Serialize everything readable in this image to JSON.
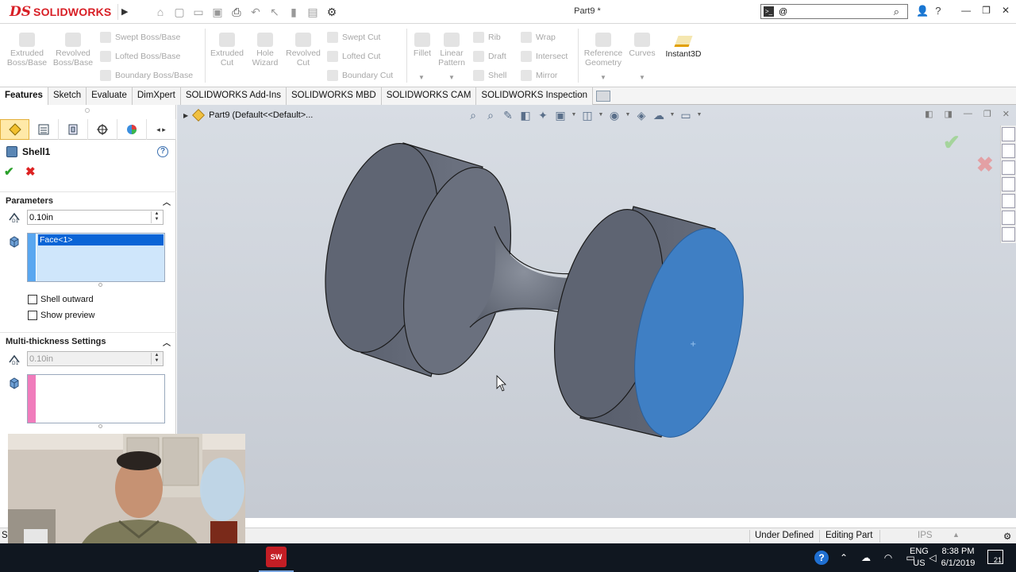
{
  "app": {
    "brand": "SOLIDWORKS",
    "document_title": "Part9 *"
  },
  "search": {
    "value": "@"
  },
  "command_manager": {
    "col1": [
      {
        "label": "Extruded Boss/Base"
      },
      {
        "label": "Revolved Boss/Base"
      }
    ],
    "col1_small": [
      "Swept Boss/Base",
      "Lofted Boss/Base",
      "Boundary Boss/Base"
    ],
    "col2": [
      {
        "label": "Extruded Cut"
      },
      {
        "label": "Hole Wizard"
      },
      {
        "label": "Revolved Cut"
      }
    ],
    "col2_small": [
      "Swept Cut",
      "Lofted Cut",
      "Boundary Cut"
    ],
    "col3": [
      {
        "label": "Fillet"
      },
      {
        "label": "Linear Pattern"
      }
    ],
    "col3_small": [
      "Rib",
      "Draft",
      "Shell"
    ],
    "col3_small2": [
      "Wrap",
      "Intersect",
      "Mirror"
    ],
    "col4": [
      {
        "label": "Reference Geometry"
      },
      {
        "label": "Curves"
      }
    ],
    "instant3d": "Instant3D"
  },
  "tabs": [
    "Features",
    "Sketch",
    "Evaluate",
    "DimXpert",
    "SOLIDWORKS Add-Ins",
    "SOLIDWORKS MBD",
    "SOLIDWORKS CAM",
    "SOLIDWORKS Inspection"
  ],
  "property_manager": {
    "title": "Shell1",
    "parameters_header": "Parameters",
    "thickness": "0.10in",
    "faces": [
      "Face<1>"
    ],
    "shell_outward": "Shell outward",
    "show_preview": "Show preview",
    "multi_header": "Multi-thickness Settings",
    "multi_thickness": "0.10in"
  },
  "viewport": {
    "tree_label": "Part9  (Default<<Default>..."
  },
  "statusbar": {
    "status": "Under Defined",
    "mode": "Editing Part",
    "units": "IPS",
    "left": "Se"
  },
  "taskbar": {
    "app_badge": "SW 2018",
    "lang1": "ENG",
    "lang2": "US",
    "time": "8:38 PM",
    "date": "6/1/2019",
    "notifications": "21"
  },
  "colors": {
    "selected_face": "#3f7fc4",
    "body": "#5e6472",
    "accent": "#d81f26"
  }
}
